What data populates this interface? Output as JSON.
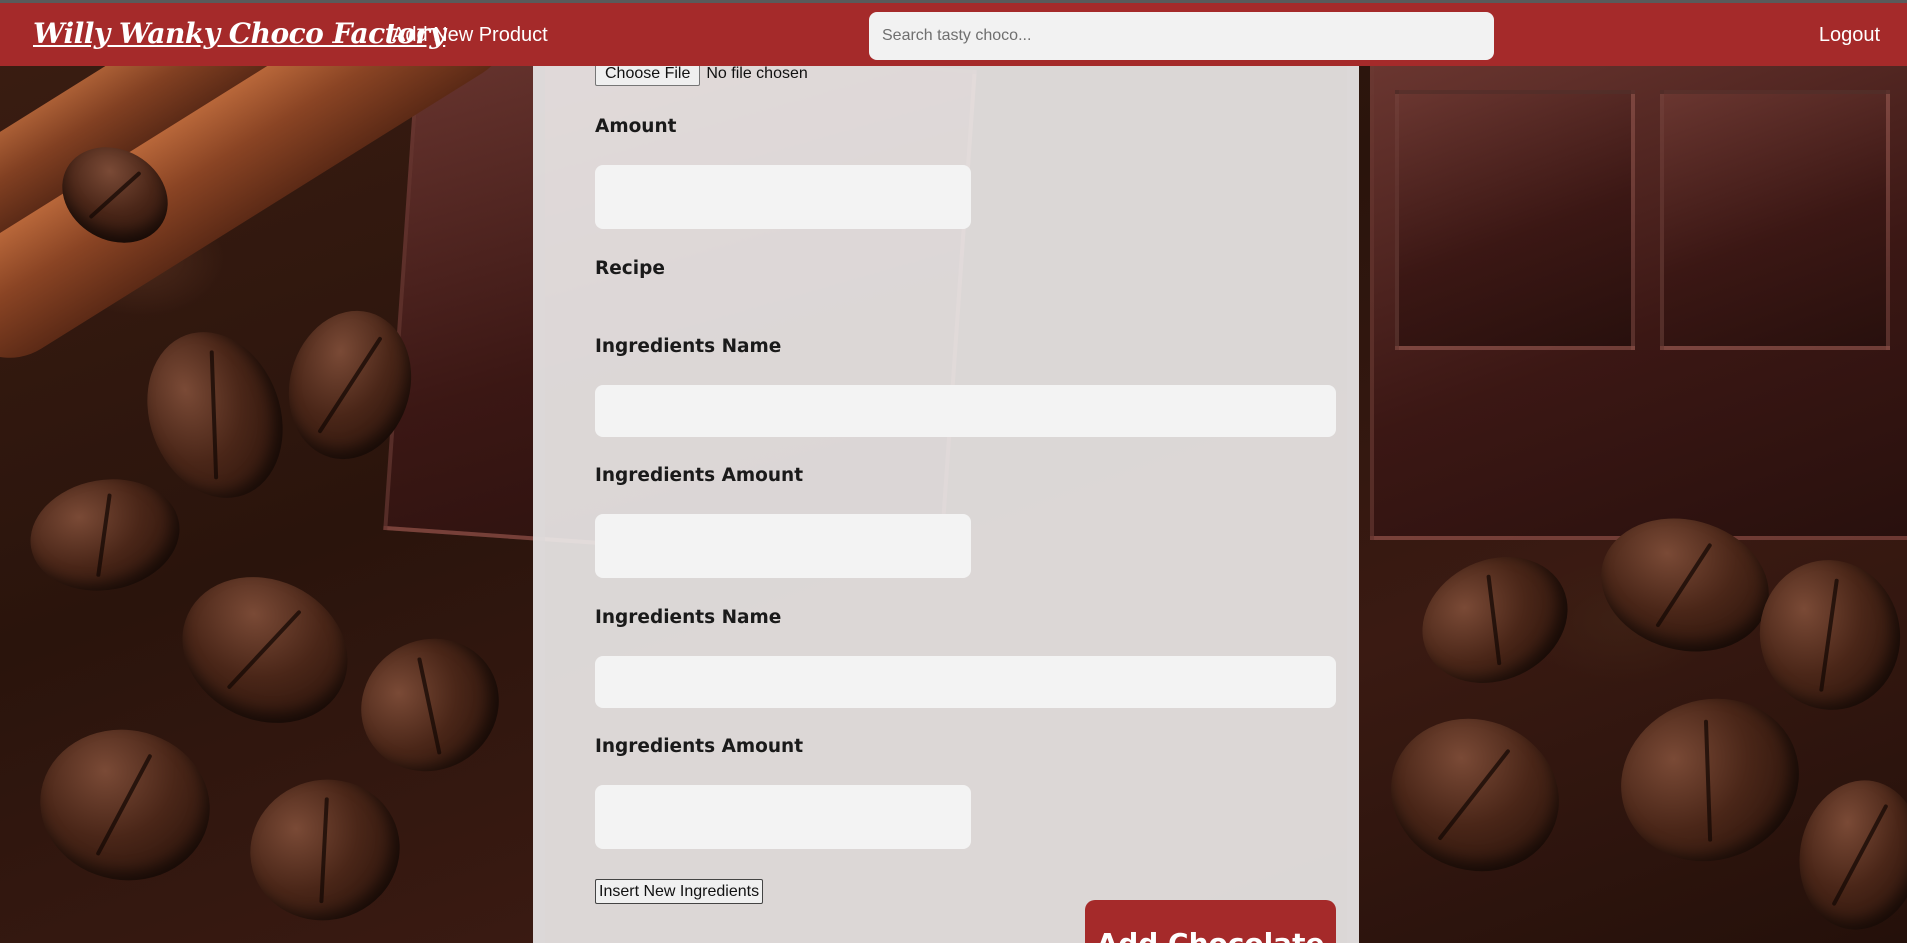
{
  "navbar": {
    "brand": "Willy Wanky Choco Factory",
    "add_product_link": "Add New Product",
    "search_placeholder": "Search tasty choco...",
    "logout_link": "Logout"
  },
  "form": {
    "file_button": "Choose File",
    "file_status": "No file chosen",
    "amount_label": "Amount",
    "recipe_label": "Recipe",
    "ingredients": [
      {
        "name_label": "Ingredients Name",
        "amount_label": "Ingredients Amount"
      },
      {
        "name_label": "Ingredients Name",
        "amount_label": "Ingredients Amount"
      }
    ],
    "insert_button": "Insert New Ingredients",
    "submit_button": "Add Chocolate"
  },
  "colors": {
    "brand_red": "#a52a2a",
    "panel": "#eeecec",
    "input_bg": "#f3f3f3"
  }
}
